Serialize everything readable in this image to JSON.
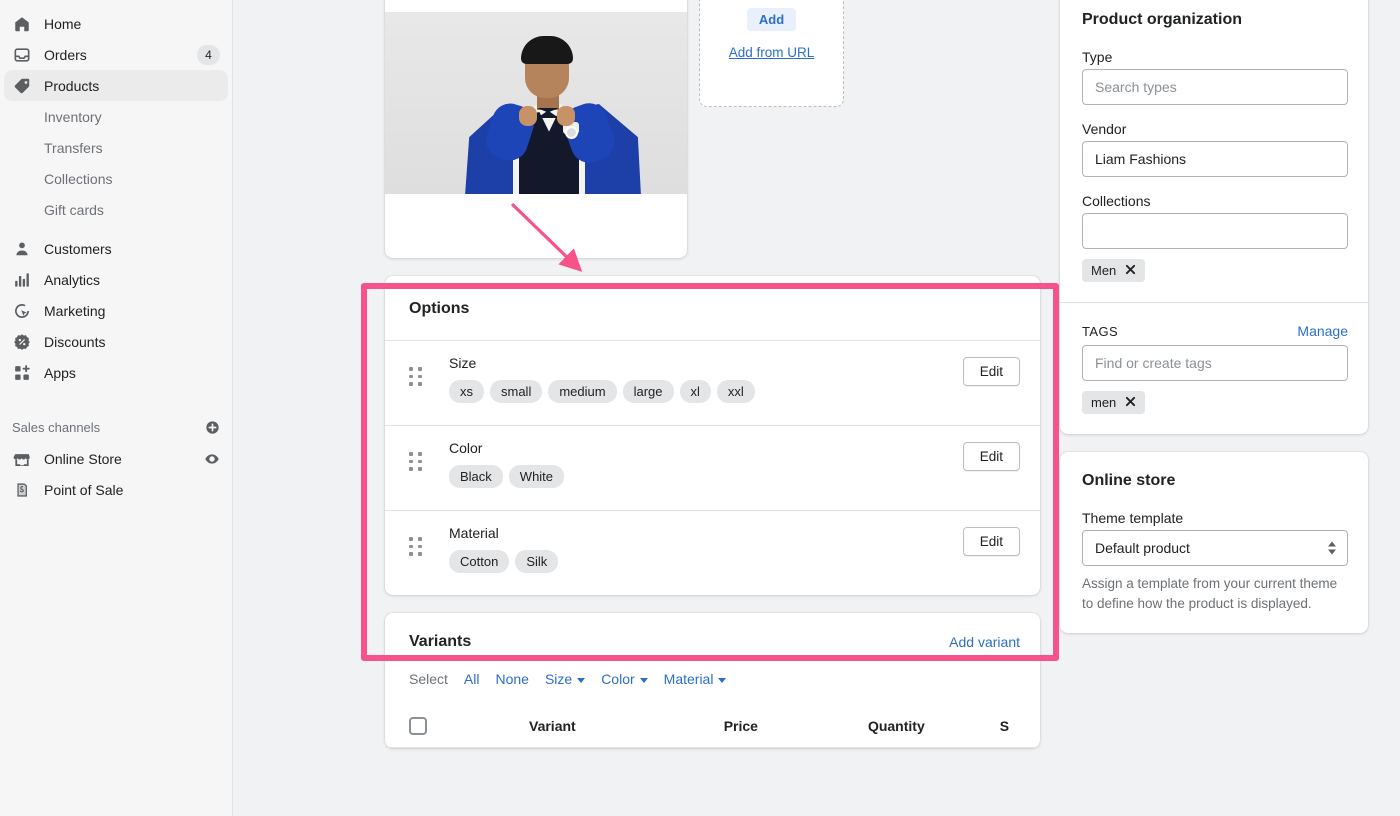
{
  "sidebar": {
    "items": [
      {
        "label": "Home",
        "icon": "home-icon",
        "badge": null
      },
      {
        "label": "Orders",
        "icon": "orders-icon",
        "badge": "4"
      },
      {
        "label": "Products",
        "icon": "products-icon",
        "badge": null,
        "active": true
      }
    ],
    "sub_items": [
      {
        "label": "Inventory"
      },
      {
        "label": "Transfers"
      },
      {
        "label": "Collections"
      },
      {
        "label": "Gift cards"
      }
    ],
    "items2": [
      {
        "label": "Customers",
        "icon": "customers-icon"
      },
      {
        "label": "Analytics",
        "icon": "analytics-icon"
      },
      {
        "label": "Marketing",
        "icon": "marketing-icon"
      },
      {
        "label": "Discounts",
        "icon": "discounts-icon"
      },
      {
        "label": "Apps",
        "icon": "apps-icon"
      }
    ],
    "sales_channels_label": "Sales channels",
    "channels": [
      {
        "label": "Online Store",
        "icon": "store-icon",
        "trailing_icon": "eye-icon"
      },
      {
        "label": "Point of Sale",
        "icon": "pos-icon",
        "trailing_icon": null
      }
    ]
  },
  "media": {
    "add_button": "Add",
    "add_from_url": "Add from URL"
  },
  "options": {
    "title": "Options",
    "edit_label": "Edit",
    "rows": [
      {
        "name": "Size",
        "values": [
          "xs",
          "small",
          "medium",
          "large",
          "xl",
          "xxl"
        ]
      },
      {
        "name": "Color",
        "values": [
          "Black",
          "White"
        ]
      },
      {
        "name": "Material",
        "values": [
          "Cotton",
          "Silk"
        ]
      }
    ]
  },
  "variants": {
    "title": "Variants",
    "add_variant": "Add variant",
    "select_label": "Select",
    "select_all": "All",
    "select_none": "None",
    "filters": [
      {
        "label": "Size"
      },
      {
        "label": "Color"
      },
      {
        "label": "Material"
      }
    ],
    "columns": {
      "variant": "Variant",
      "price": "Price",
      "quantity": "Quantity",
      "sku": "S"
    }
  },
  "product_organization": {
    "title": "Product organization",
    "type_label": "Type",
    "type_placeholder": "Search types",
    "type_value": "",
    "vendor_label": "Vendor",
    "vendor_value": "Liam Fashions",
    "collections_label": "Collections",
    "collections_value": "",
    "collection_tag": "Men",
    "tags_title": "TAGS",
    "manage_label": "Manage",
    "tags_placeholder": "Find or create tags",
    "tags_value": "",
    "tag": "men"
  },
  "online_store": {
    "title": "Online store",
    "theme_template_label": "Theme template",
    "theme_template_value": "Default product",
    "help_text": "Assign a template from your current theme to define how the product is displayed."
  },
  "annotations": {
    "highlight_color": "#f7528a",
    "arrow_color": "#f7528a"
  }
}
